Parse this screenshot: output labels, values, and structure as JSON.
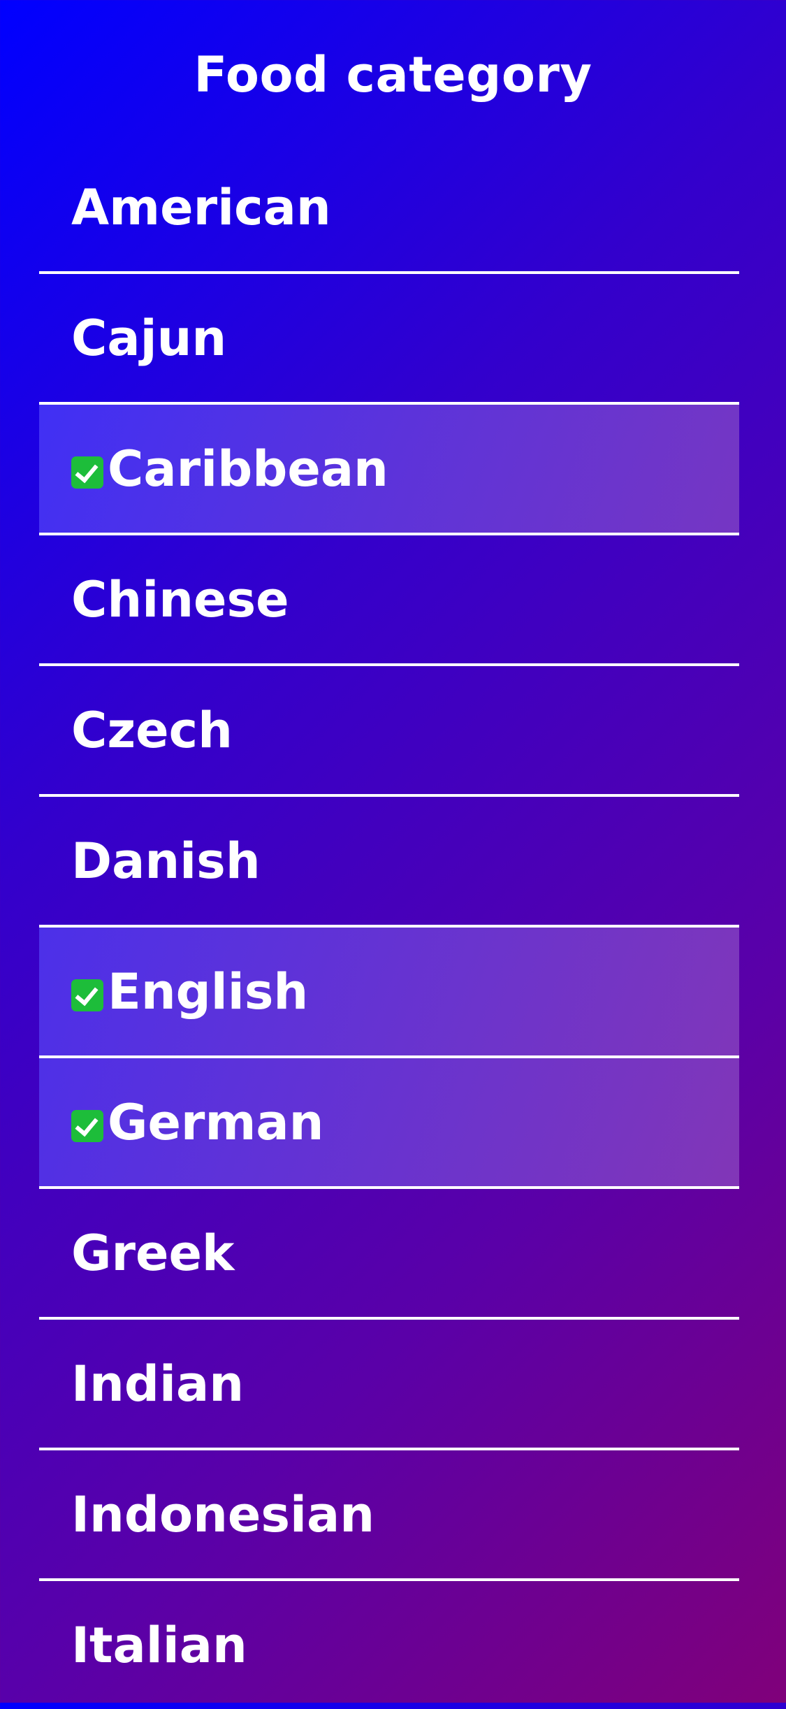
{
  "header": {
    "title": "Food category"
  },
  "categories": [
    {
      "label": "American",
      "selected": false
    },
    {
      "label": "Cajun",
      "selected": false
    },
    {
      "label": "Caribbean",
      "selected": true
    },
    {
      "label": "Chinese",
      "selected": false
    },
    {
      "label": "Czech",
      "selected": false
    },
    {
      "label": "Danish",
      "selected": false
    },
    {
      "label": "English",
      "selected": true
    },
    {
      "label": "German",
      "selected": true
    },
    {
      "label": "Greek",
      "selected": false
    },
    {
      "label": "Indian",
      "selected": false
    },
    {
      "label": "Indonesian",
      "selected": false
    },
    {
      "label": "Italian",
      "selected": false
    }
  ],
  "colors": {
    "gradient_start": "#0000ff",
    "gradient_end": "#80007a",
    "check_green": "#1dbd3a",
    "text": "#ffffff"
  },
  "icons": {
    "selected_marker": "check-box-icon"
  }
}
